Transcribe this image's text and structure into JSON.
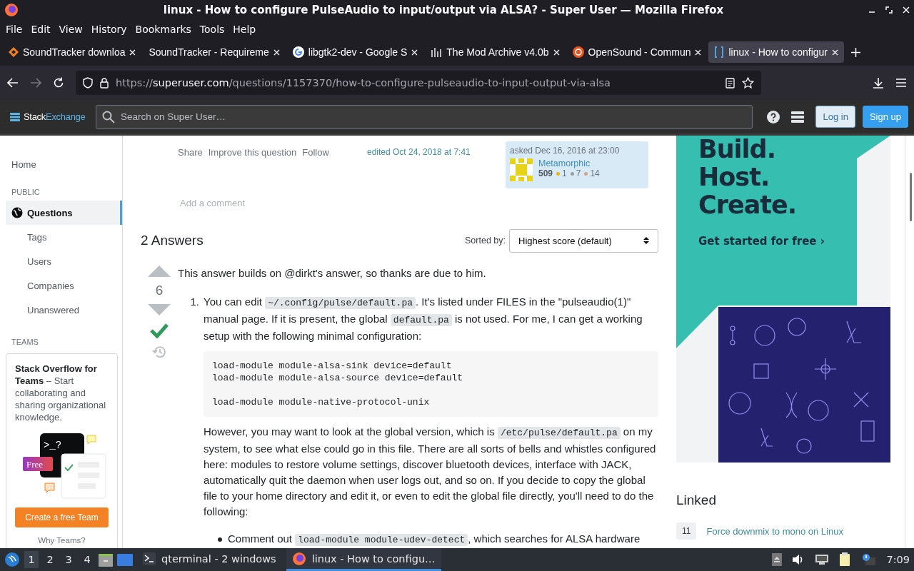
{
  "window": {
    "title": "linux - How to configure PulseAudio to input/output via ALSA? - Super User — Mozilla Firefox"
  },
  "menu": [
    "File",
    "Edit",
    "View",
    "History",
    "Bookmarks",
    "Tools",
    "Help"
  ],
  "tabs": [
    {
      "label": "SoundTracker downloa",
      "kind": "diamond",
      "selected": false
    },
    {
      "label": "SoundTracker - Requireme",
      "kind": "none",
      "selected": false
    },
    {
      "label": "libgtk2-dev - Google S",
      "kind": "google",
      "selected": false
    },
    {
      "label": "The Mod Archive v4.0b",
      "kind": "bars",
      "selected": false
    },
    {
      "label": "OpenSound - Commun",
      "kind": "ubuntu",
      "selected": false
    },
    {
      "label": "linux - How to configur",
      "kind": "brackets",
      "selected": true
    }
  ],
  "url": {
    "scheme": "https://",
    "domain": "superuser.com",
    "path": "/questions/1157370/how-to-configure-pulseaudio-to-input-output-via-alsa"
  },
  "site_header": {
    "logo_a": "Stack",
    "logo_b": "Exchange",
    "search_placeholder": "Search on Super User…",
    "login": "Log in",
    "signup": "Sign up"
  },
  "sidebar": {
    "home": "Home",
    "public_label": "PUBLIC",
    "items": [
      {
        "label": "Questions",
        "selected": true
      },
      {
        "label": "Tags",
        "selected": false
      },
      {
        "label": "Users",
        "selected": false
      },
      {
        "label": "Companies",
        "selected": false
      },
      {
        "label": "Unanswered",
        "selected": false
      }
    ],
    "teams_label": "TEAMS",
    "teams": {
      "text": "**Stack Overflow for Teams** – Start collaborating and sharing organizational knowledge.",
      "prompt": ">_?",
      "badge": "Free",
      "button": "Create a free Team",
      "link": "Why Teams?"
    }
  },
  "question_footer": {
    "actions": [
      "Share",
      "Improve this question",
      "Follow"
    ],
    "edited": "edited Oct 24, 2018 at 7:41",
    "asked": {
      "label": "asked Dec 16, 2016 at 23:00",
      "user": "Metamorphic",
      "reputation": "509",
      "badges": [
        {
          "count": "1",
          "color": "#f1b600"
        },
        {
          "count": "7",
          "color": "#9a9ea3"
        },
        {
          "count": "14",
          "color": "#d1a684"
        }
      ]
    }
  },
  "add_comment": "Add a comment",
  "answers": {
    "title": "2 Answers",
    "sort_label": "Sorted by:",
    "sort_value": "Highest score (default)"
  },
  "answer": {
    "votes": "6",
    "accepted": true,
    "item_number": "1.",
    "intro": "This answer builds on @dirkt's answer, so thanks are due to him.",
    "item_1": [
      {
        "kind": "text",
        "text": "You can edit "
      },
      {
        "kind": "code",
        "text": "~/.config/pulse/default.pa"
      },
      {
        "kind": "text",
        "text": ". It's listed under FILES in the \"pulseaudio(1)\" manual page. If it is present, the global "
      },
      {
        "kind": "code",
        "text": "default.pa"
      },
      {
        "kind": "text",
        "text": " is not used. For me, I can get a working setup with the following minimal configuration:"
      }
    ],
    "code_block": "load-module module-alsa-sink device=default\nload-module module-alsa-source device=default\n\nload-module module-native-protocol-unix",
    "paragraph": [
      {
        "kind": "text",
        "text": "However, you may want to look at the global version, which is "
      },
      {
        "kind": "code",
        "text": "/etc/pulse/default.pa"
      },
      {
        "kind": "text",
        "text": " on my system, to see what else could go in this file. There are all sorts of bells and whistles configured here: modules to restore volume settings, discover bluetooth devices, interface with JACK, automatically quit the daemon when user logs out, and so on. If you decide to copy the global file to your home directory and edit it, or even to edit the global file directly, you'll need to do the following:"
      }
    ],
    "bullet": [
      {
        "kind": "text",
        "text": "Comment out "
      },
      {
        "kind": "code",
        "text": "load-module module-udev-detect"
      },
      {
        "kind": "text",
        "text": ", which searches for ALSA hardware"
      }
    ]
  },
  "ad": {
    "lines": [
      "Build.",
      "Host.",
      "Create."
    ],
    "cta": "Get started for free ›"
  },
  "linked": {
    "title": "Linked",
    "items": [
      {
        "count": "11",
        "title": "Force downmix to mono on Linux"
      }
    ]
  },
  "taskbar": {
    "workspaces": [
      {
        "label": "1",
        "selected": true
      },
      {
        "label": "2",
        "selected": false
      },
      {
        "label": "3",
        "selected": false
      },
      {
        "label": "4",
        "selected": false
      }
    ],
    "tasks": [
      {
        "label": "qterminal - 2 windows",
        "kind": "terminal",
        "selected": false
      },
      {
        "label": "linux - How to configu…",
        "kind": "firefox",
        "selected": true
      }
    ],
    "clock": "7:09"
  }
}
